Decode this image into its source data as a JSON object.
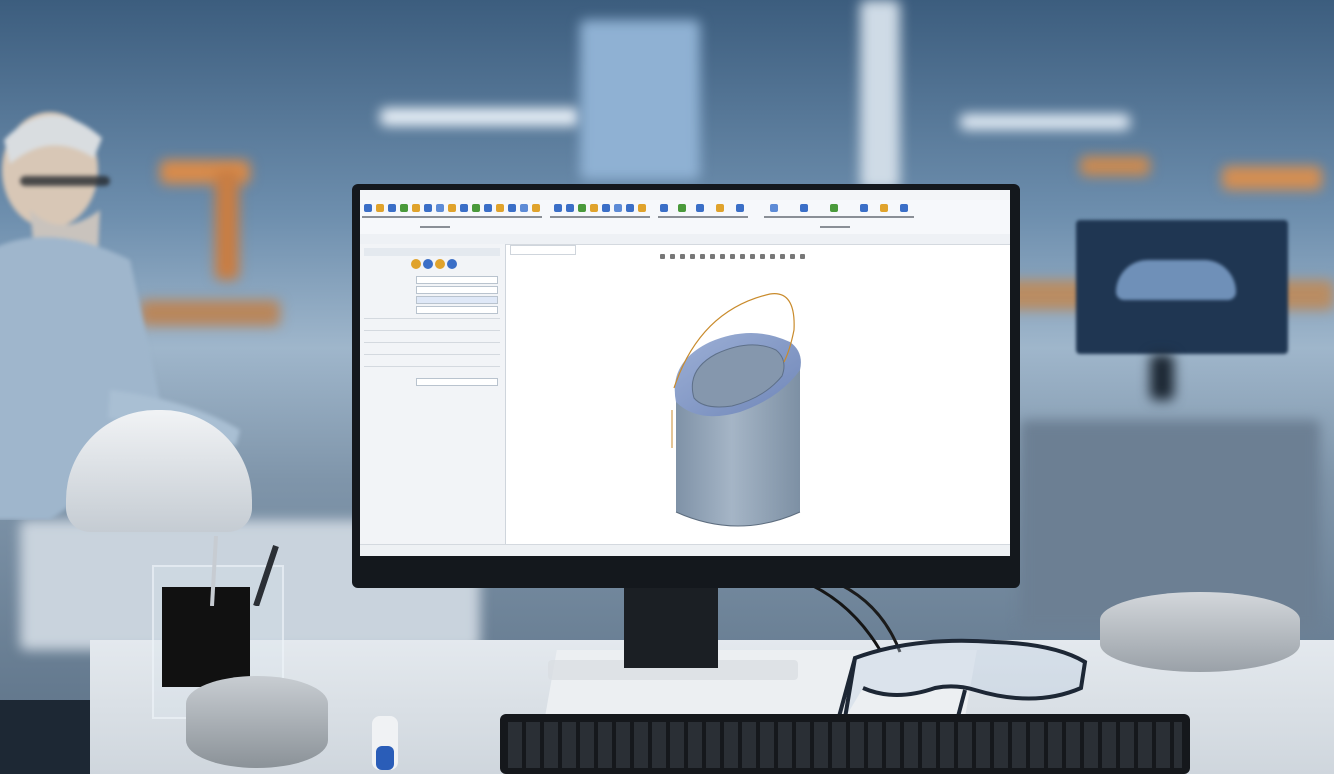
{
  "image": {
    "description_free": true
  },
  "cad_app": {
    "title": "",
    "status": "",
    "tab": "",
    "colors": {
      "model": "#8ea1b6",
      "model_dark": "#6f8297",
      "sketch_line": "#c98b2c",
      "ribbon_bg": "#f6f8fb",
      "panel_bg": "#f2f4f7",
      "viewport_bg": "#ffffff"
    }
  },
  "scene": {
    "icons": [
      "monitor-icon",
      "keyboard-icon",
      "safety-glasses-icon",
      "hard-hat-icon",
      "pen-holder-icon"
    ]
  }
}
